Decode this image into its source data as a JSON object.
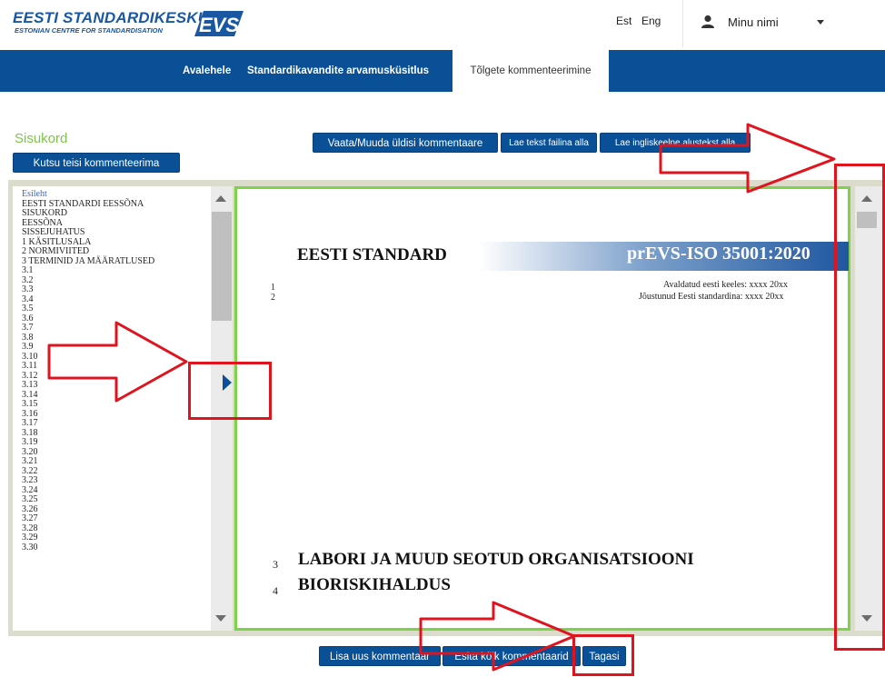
{
  "header": {
    "logo_line1": "EESTI STANDARDIKESKUS",
    "logo_line2": "ESTONIAN CENTRE FOR STANDARDISATION",
    "logo_mark": "EVS",
    "lang_est": "Est",
    "lang_eng": "Eng",
    "user_name": "Minu nimi",
    "icons": {
      "user": "user-icon",
      "caret": "chevron-down-icon"
    }
  },
  "nav": {
    "items": [
      "Avalehele",
      "Standardikavandite arvamusküsitlus",
      "Tõlgete kommenteerimine"
    ],
    "active_index": 2
  },
  "toolbar": {
    "toc_title": "Sisukord",
    "invite_label": "Kutsu teisi kommenteerima",
    "view_general_label": "Vaata/Muuda üldisi kommentaare",
    "download_text_label": "Lae tekst failina alla",
    "download_english_label": "Lae ingliskeelne alustekst alla"
  },
  "toc": {
    "items": [
      "Esileht",
      "EESTI STANDARDI EESSÕNA",
      "SISUKORD",
      "EESSÕNA",
      "SISSEJUHATUS",
      "1 KÄSITLUSALA",
      "2 NORMIVIITED",
      "3 TERMINID JA MÄÄRATLUSED",
      "3.1",
      "3.2",
      "3.3",
      "3.4",
      "3.5",
      "3.6",
      "3.7",
      "3.8",
      "3.9",
      "3.10",
      "3.11",
      "3.12",
      "3.13",
      "3.14",
      "3.15",
      "3.16",
      "3.17",
      "3.18",
      "3.19",
      "3.20",
      "3.21",
      "3.22",
      "3.23",
      "3.24",
      "3.25",
      "3.26",
      "3.27",
      "3.28",
      "3.29",
      "3.30"
    ]
  },
  "document": {
    "title_left": "EESTI STANDARD",
    "title_right": "prEVS-ISO 35001:2020",
    "lines": [
      {
        "no": "1",
        "text": "Avaldatud eesti keeles: xxxx 20xx"
      },
      {
        "no": "2",
        "text": "Jõustunud Eesti standardina: xxxx 20xx"
      }
    ],
    "headings": [
      {
        "no": "3",
        "text": "LABORI JA MUUD SEOTUD ORGANISATSIOONI"
      },
      {
        "no": "4",
        "text": "BIORISKIHALDUS"
      }
    ]
  },
  "footer": {
    "add_comment_label": "Lisa uus kommentaar",
    "submit_all_label": "Esita kõik kommentaarid",
    "back_label": "Tagasi"
  },
  "annotations": {
    "color": "#e0141e"
  },
  "colors": {
    "brand": "#0a5096",
    "accent_green": "#7ec44a"
  }
}
